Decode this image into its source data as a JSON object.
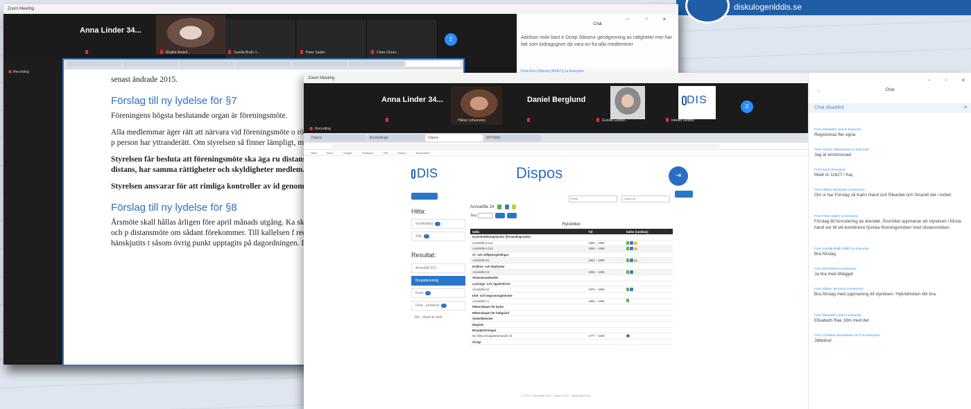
{
  "brand": {
    "url": "diskulogenlddis.se"
  },
  "back_window": {
    "title": "Zoom Meeting",
    "participants": [
      {
        "name": "Anna Linder 34...",
        "size": "big"
      },
      {
        "name": "Birgitta Bodell...",
        "size": "small"
      },
      {
        "name": "Gunilla Brath J...",
        "size": "small"
      },
      {
        "name": "Peter Sydén",
        "size": "small"
      },
      {
        "name": "Claes Göran...",
        "size": "small"
      }
    ],
    "more_count": "2",
    "recording_label": "Recording",
    "chat": {
      "title": "Chat",
      "message": "Adelson rede bast e Orotp Stbstrur gendgenning av rattgheter mer har fatt som bidragsgiver da vara en fra alla medlemmer",
      "from": "From Kris Uhlemöi (400671) to Everyone"
    }
  },
  "document": {
    "line0": "senast ändrade 2015.",
    "h1": "Förslag till ny lydelse för §7",
    "p1": "Föreningens högsta beslutande organ är föreningsmöte.",
    "p2": "Alla medlemmar äger rätt att närvara vid föreningsmöte o rösträtt. DIS styrelse äger därutöver rätt inbjuda annan p person har yttranderätt. Om styrelsen så finner lämpligt, möjlighet att följa förhandlingar vid föreningsmöte.",
    "p3": "Styrelsen får besluta att föreningsmöte ska äga ru distansmöte, eller som en kombination av dessa. distans, har samma rättigheter och skyldigheter medlem.",
    "p4": "Styrelsen ansvarar för att rimliga kontroller av id genomförs oberoende av mötesform.",
    "h2": "Förslag till ny lydelse för §8",
    "p5": "Årsmöte skall hållas årligen före april månads utgång. Ka skriftligen av DIS styrelse med angivande av datum och p distansmöte om sådant förekommer. Till kallelsen f redogörelse för ärenden som av DIS styrelse hänskjutits t såsom övrig punkt upptagits på dagordningen. Inkomna"
  },
  "front_window": {
    "title": "Zoom Meeting",
    "participants": [
      {
        "name": "Anna Linder 34..."
      },
      {
        "name": "Håkan Johansson"
      },
      {
        "name": "Daniel Berglund"
      },
      {
        "name": "Gunilla Gustav..."
      },
      {
        "name": "Inkeed Sinstris"
      }
    ],
    "dis_tile": "DIS",
    "more_count": "2",
    "recording_label": "Recording",
    "browser_tabs": [
      "Dispos",
      "Anomidirapr",
      "Dispos",
      "SPYWeb"
    ],
    "bookmarks": [
      "Sites",
      "Inbox",
      "Google",
      "Transport",
      "DIS",
      "Dispos",
      "Bookmarks"
    ],
    "site": {
      "logo": "DIS",
      "title": "Dispos",
      "login_fields": [
        "Email",
        "Lösenord"
      ],
      "sidebar": {
        "hitta": "Hitta:",
        "hitta_rows": [
          "Vivarbeting",
          "Sök"
        ],
        "resultat": "Resultat:",
        "resultat_rows": [
          "Arvsskiftl 213",
          "Bouppteckning",
          "Kvarl",
          "Dom-, protokoll",
          "Mo-, tinasl pi ratte"
        ]
      },
      "table_top": "Arvsskifte 24",
      "search_label": "Text",
      "caption": "Rylsbriker",
      "columns": [
        "Källa",
        "Tid",
        "Kallor (ramklas)"
      ],
      "rows": [
        {
          "type": "group",
          "cells": [
            "Kyrkobokföringsbyråer (församlingsarkiv)",
            "",
            ""
          ]
        },
        {
          "type": "row",
          "cells": [
            "Arvsskifte 8:114",
            "1883 – 1896",
            "gby"
          ]
        },
        {
          "type": "row",
          "cells": [
            "Arvsskifte 8:114",
            "1884 – 1896",
            "gby"
          ]
        },
        {
          "type": "group",
          "cells": [
            "Ar- och selfgemrgeidtngar",
            "",
            ""
          ]
        },
        {
          "type": "row",
          "cells": [
            "Arvsskifte B1",
            "1861 – 1896",
            "gby"
          ]
        },
        {
          "type": "group",
          "cells": [
            "Dodbos- och depånetar",
            "",
            ""
          ]
        },
        {
          "type": "row",
          "cells": [
            "Arvsskifte C5",
            "1863 – 1896",
            "gb"
          ]
        },
        {
          "type": "group",
          "cells": [
            "Stammanumbarkiv",
            "",
            ""
          ]
        },
        {
          "type": "group",
          "cells": [
            "Lysnings- och vigselskriver",
            "",
            ""
          ]
        },
        {
          "type": "row",
          "cells": [
            "Arvsskifte E3",
            "1876 – 1895",
            "gb"
          ]
        },
        {
          "type": "group",
          "cells": [
            "Död- och begravningsböcker",
            "",
            ""
          ]
        },
        {
          "type": "row",
          "cells": [
            "Arvsskifte F1",
            "1883 – 1896",
            "g"
          ]
        },
        {
          "type": "group",
          "cells": [
            "Räkenskaper för kyrka",
            "",
            ""
          ]
        },
        {
          "type": "group",
          "cells": [
            "Räkenskaper för fattigvård",
            "",
            ""
          ]
        },
        {
          "type": "group",
          "cells": [
            "Statistikböcker",
            "",
            ""
          ]
        },
        {
          "type": "group",
          "cells": [
            "Register",
            "",
            ""
          ]
        },
        {
          "type": "group",
          "cells": [
            "Bouppteckningar",
            "",
            ""
          ]
        },
        {
          "type": "row",
          "cells": [
            "Ny hlärva-bouppteckmande nb",
            "1777 – 1849",
            "c"
          ]
        },
        {
          "type": "group",
          "cells": [
            "Övrigt",
            "",
            ""
          ]
        }
      ],
      "footer": "© 2021 Föreningen DIS · Dispos 2021 · datapublicering"
    }
  },
  "chat": {
    "title": "Chat",
    "disabled_label": "Chat disabled",
    "messages": [
      {
        "from": "From Elisabeth Leek to Everyone",
        "text": "Registreras fler egna"
      },
      {
        "from": "From Anders Hjalmarsson to Everyone",
        "text": "Jag är emotrosvad"
      },
      {
        "from": "From Kaj to Everyone",
        "text": "Medl nr 11627 / Kaj"
      },
      {
        "from": "From Håkan Westmark to Everyone",
        "text": "Om vi har Förslag så Karin Hand och Rikardet och Strandt det i mötet."
      },
      {
        "from": "From Peter Sydén to Everyone",
        "text": "Förslag till formulering av ärendet. Årsmötet uppmanar att styrelsen i första hand ser till ett kombinera fysiska föreningsmöten med distansmöten."
      },
      {
        "from": "From Gunilla Brath (4067) to Everyone",
        "text": "Bra förslag"
      },
      {
        "from": "From Britt Weber to Everyone",
        "text": "Ja bra med tillägget"
      },
      {
        "from": "From Håkan Jeronsch to Everyone",
        "text": "Bra förslag med uppmaning till styrelsen. Hybridmöten blir bra."
      },
      {
        "from": "From Elisabeth Leek to Everyone",
        "text": "Elisabeth Rae 18m med det"
      },
      {
        "from": "From Christina Samuelsson (677) to Everyone",
        "text": "Jättebra!"
      }
    ]
  }
}
